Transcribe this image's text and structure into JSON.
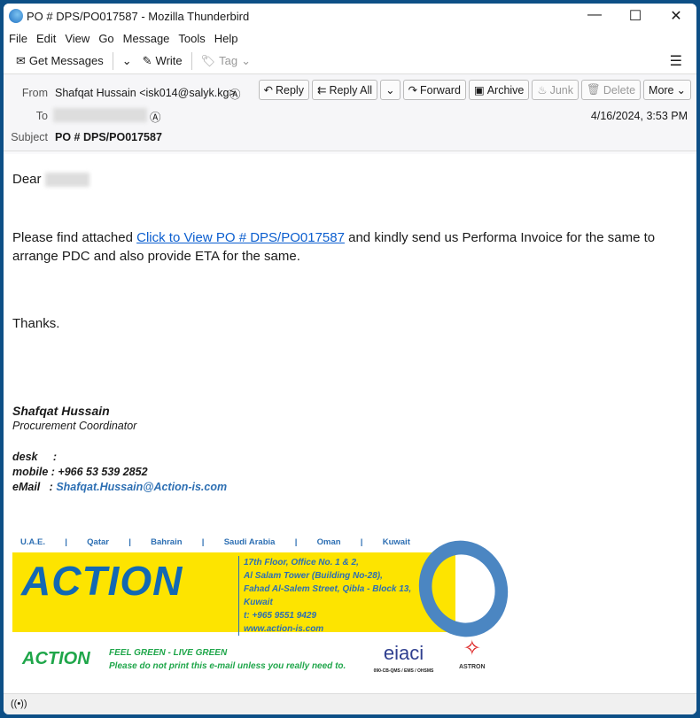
{
  "window": {
    "title": "PO # DPS/PO017587 - Mozilla Thunderbird",
    "minimize": "—",
    "maximize": "☐",
    "close": "✕"
  },
  "menu": [
    "File",
    "Edit",
    "View",
    "Go",
    "Message",
    "Tools",
    "Help"
  ],
  "toolbar": {
    "get_messages": "Get Messages",
    "write": "Write",
    "tag": "Tag"
  },
  "header": {
    "from_label": "From",
    "from": "Shafqat Hussain <isk014@salyk.kg>",
    "to_label": "To",
    "subject_label": "Subject",
    "subject": "PO # DPS/PO017587",
    "date": "4/16/2024, 3:53 PM",
    "buttons": {
      "reply": "Reply",
      "reply_all": "Reply All",
      "forward": "Forward",
      "archive": "Archive",
      "junk": "Junk",
      "delete": "Delete",
      "more": "More"
    }
  },
  "body": {
    "greeting": "Dear",
    "p1_before": "Please find attached ",
    "link": "Click to View PO # DPS/PO017587",
    "p1_after": " and kindly send us Performa Invoice for the same to arrange PDC and also provide ETA for the same.",
    "thanks": "Thanks.",
    "sig_name": "Shafqat Hussain",
    "sig_title": "Procurement Coordinator",
    "desk": "desk     :",
    "mobile": "mobile : +966 53 539 2852",
    "email_label": "eMail   : ",
    "email": "Shafqat.Hussain@Action-is.com"
  },
  "banner": {
    "countries": [
      "U.A.E.",
      "|",
      "Qatar",
      "|",
      "Bahrain",
      "|",
      "Saudi Arabia",
      "|",
      "Oman",
      "|",
      "Kuwait"
    ],
    "logo": "ACTION",
    "address": [
      "17th Floor, Office No. 1 & 2,",
      "Al Salam Tower (Building No-28),",
      "Fahad Al-Salem Street, Qibla - Block 13,",
      "Kuwait",
      "t: +965 9551 9429",
      "www.action-is.com"
    ],
    "green1": "FEEL GREEN - LIVE GREEN",
    "green2": "Please do not print this e-mail unless you really need to.",
    "eiac": "eiaci",
    "eiac_code": "090-CB-QMS / EMS / OHSMS",
    "astron": "ASTRON"
  },
  "colors": {
    "link": "#0b5ecf",
    "brand_yellow": "#fde400",
    "brand_blue": "#1268b3",
    "green": "#1fa64a"
  }
}
